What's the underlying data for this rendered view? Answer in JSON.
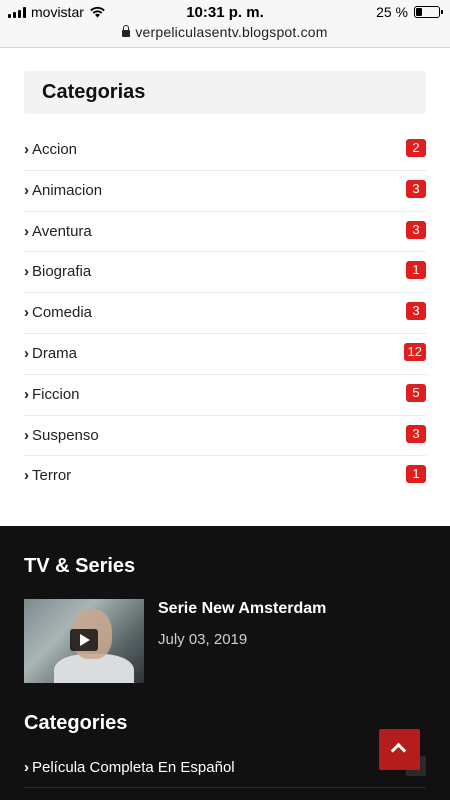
{
  "status_bar": {
    "carrier": "movistar",
    "time": "10:31 p. m.",
    "battery_text": "25 %",
    "battery_level": 0.25,
    "signal_icon": "signal-bars-icon",
    "wifi_icon": "wifi-icon",
    "battery_icon": "battery-icon"
  },
  "browser": {
    "url": "verpeliculasentv.blogspot.com",
    "lock_icon": "lock-icon"
  },
  "categorias": {
    "title": "Categorias",
    "items": [
      {
        "label": "Accion",
        "count": "2"
      },
      {
        "label": "Animacion",
        "count": "3"
      },
      {
        "label": "Aventura",
        "count": "3"
      },
      {
        "label": "Biografia",
        "count": "1"
      },
      {
        "label": "Comedia",
        "count": "3"
      },
      {
        "label": "Drama",
        "count": "12"
      },
      {
        "label": "Ficcion",
        "count": "5"
      },
      {
        "label": "Suspenso",
        "count": "3"
      },
      {
        "label": "Terror",
        "count": "1"
      }
    ],
    "chevron": "›"
  },
  "footer": {
    "tv_series_title": "TV & Series",
    "post": {
      "title": "Serie New Amsterdam",
      "date": "July 03, 2019",
      "play_icon": "play-icon"
    },
    "categories_title": "Categories",
    "categories_item": {
      "label": "Película Completa En Español",
      "count": "1"
    }
  },
  "colors": {
    "badge_red": "#e01e1e",
    "footer_bg": "#111111",
    "back_to_top": "#b51c1c"
  },
  "back_to_top_icon": "chevron-up-icon"
}
